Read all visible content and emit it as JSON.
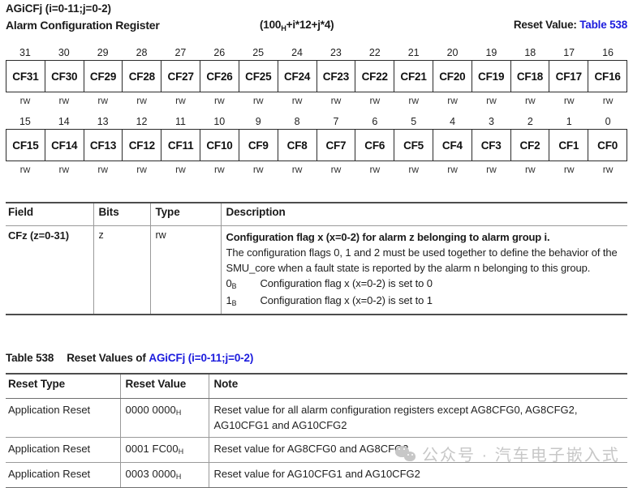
{
  "register": {
    "name": "AGiCFj (i=0-11;j=0-2)",
    "title": "Alarm Configuration Register",
    "offset_prefix": "(100",
    "offset_sub": "H",
    "offset_suffix": "+i*12+j*4)",
    "reset_label": "Reset Value:",
    "reset_link": "Table 538",
    "link_color": "#1b1bdd"
  },
  "bitfield": {
    "rows": [
      {
        "bits": [
          "31",
          "30",
          "29",
          "28",
          "27",
          "26",
          "25",
          "24",
          "23",
          "22",
          "21",
          "20",
          "19",
          "18",
          "17",
          "16"
        ],
        "names": [
          "CF31",
          "CF30",
          "CF29",
          "CF28",
          "CF27",
          "CF26",
          "CF25",
          "CF24",
          "CF23",
          "CF22",
          "CF21",
          "CF20",
          "CF19",
          "CF18",
          "CF17",
          "CF16"
        ],
        "access": [
          "rw",
          "rw",
          "rw",
          "rw",
          "rw",
          "rw",
          "rw",
          "rw",
          "rw",
          "rw",
          "rw",
          "rw",
          "rw",
          "rw",
          "rw",
          "rw"
        ]
      },
      {
        "bits": [
          "15",
          "14",
          "13",
          "12",
          "11",
          "10",
          "9",
          "8",
          "7",
          "6",
          "5",
          "4",
          "3",
          "2",
          "1",
          "0"
        ],
        "names": [
          "CF15",
          "CF14",
          "CF13",
          "CF12",
          "CF11",
          "CF10",
          "CF9",
          "CF8",
          "CF7",
          "CF6",
          "CF5",
          "CF4",
          "CF3",
          "CF2",
          "CF1",
          "CF0"
        ],
        "access": [
          "rw",
          "rw",
          "rw",
          "rw",
          "rw",
          "rw",
          "rw",
          "rw",
          "rw",
          "rw",
          "rw",
          "rw",
          "rw",
          "rw",
          "rw",
          "rw"
        ]
      }
    ]
  },
  "field_table": {
    "headers": {
      "field": "Field",
      "bits": "Bits",
      "type": "Type",
      "description": "Description"
    },
    "rows": [
      {
        "field": "CFz (z=0-31)",
        "bits": "z",
        "type": "rw",
        "desc_title": "Configuration flag x (x=0-2) for alarm z belonging to alarm group i.",
        "desc_body": "The configuration flags 0, 1 and 2 must be used together to define the behavior of the SMU_core when a fault state is reported by the alarm n belonging to this group.",
        "enums": [
          {
            "key": "0",
            "key_sub": "B",
            "value": "Configuration flag x (x=0-2) is set to 0"
          },
          {
            "key": "1",
            "key_sub": "B",
            "value": "Configuration flag x (x=0-2) is set to 1"
          }
        ]
      }
    ]
  },
  "reset_table": {
    "caption_number": "Table 538",
    "caption_text": "Reset Values of",
    "caption_link": "AGiCFj (i=0-11;j=0-2)",
    "headers": {
      "reset_type": "Reset Type",
      "reset_value": "Reset Value",
      "note": "Note"
    },
    "rows": [
      {
        "reset_type": "Application Reset",
        "reset_value": "0000 0000",
        "reset_value_sub": "H",
        "note": "Reset value for all alarm configuration registers except AG8CFG0, AG8CFG2, AG10CFG1 and AG10CFG2"
      },
      {
        "reset_type": "Application Reset",
        "reset_value": "0001 FC00",
        "reset_value_sub": "H",
        "note": "Reset value for AG8CFG0 and AG8CFG2"
      },
      {
        "reset_type": "Application Reset",
        "reset_value": "0003 0000",
        "reset_value_sub": "H",
        "note": "Reset value for AG10CFG1 and AG10CFG2"
      }
    ]
  },
  "watermark": {
    "text": "公众号 · 汽车电子嵌入式"
  }
}
